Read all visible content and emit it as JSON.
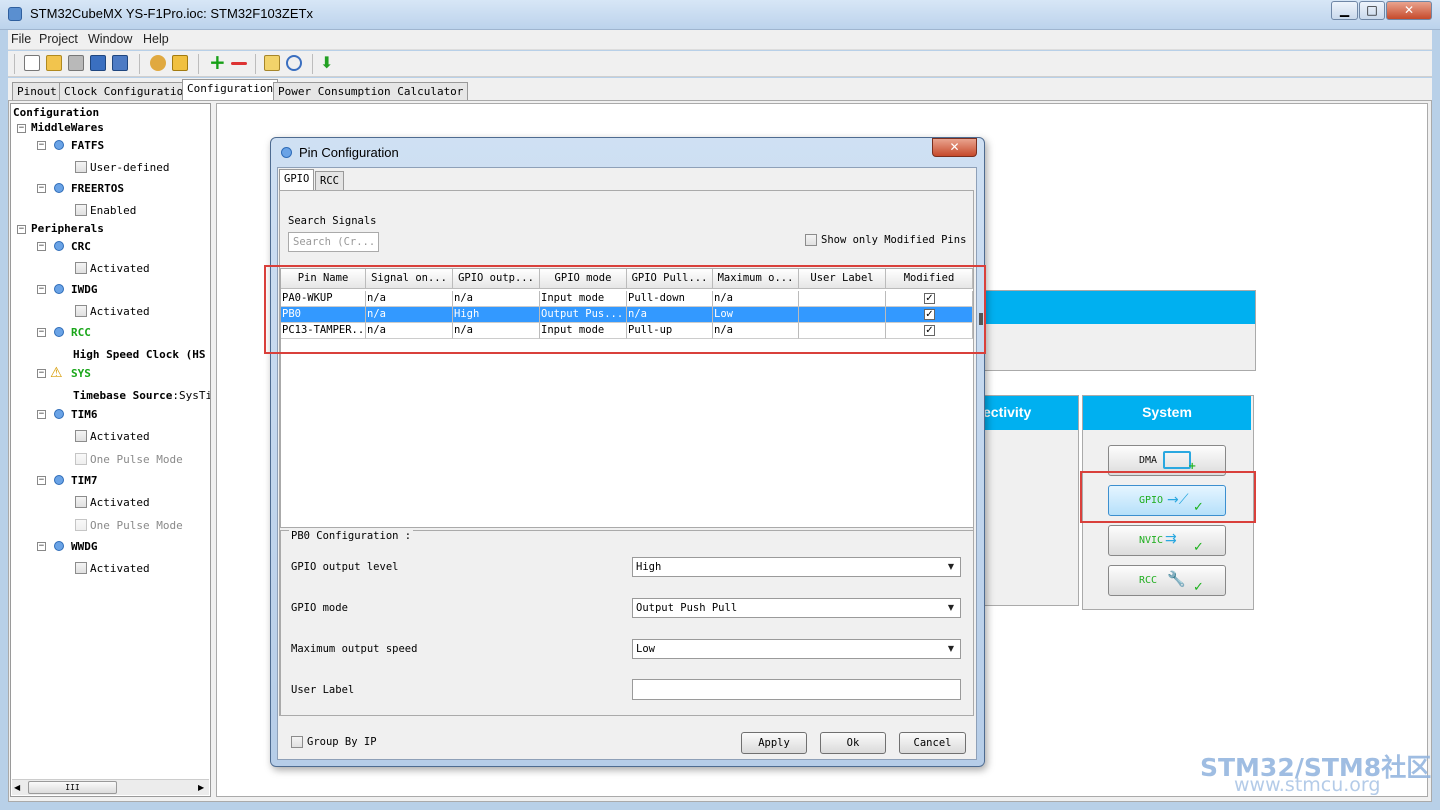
{
  "window": {
    "title": "STM32CubeMX YS-F1Pro.ioc: STM32F103ZETx",
    "min": "▁",
    "max": "□",
    "close": "✕"
  },
  "menu": [
    "File",
    "Project",
    "Window",
    "Help"
  ],
  "tabs": [
    "Pinout",
    "Clock Configuration",
    "Configuration",
    "Power Consumption Calculator"
  ],
  "tree": {
    "root": "Configuration",
    "middlewares": "MiddleWares",
    "fatfs": "FATFS",
    "fatfs_opt": "User-defined",
    "freertos": "FREERTOS",
    "freertos_opt": "Enabled",
    "peripherals": "Peripherals",
    "crc": "CRC",
    "crc_opt": "Activated",
    "iwdg": "IWDG",
    "iwdg_opt": "Activated",
    "rcc": "RCC",
    "rcc_opt_label": "High Speed Clock (HS",
    "sys": "SYS",
    "sys_opt_label": "Timebase Source",
    "sys_opt_value": ":SysTi",
    "tim6": "TIM6",
    "tim6_opt1": "Activated",
    "tim6_opt2": "One Pulse Mode",
    "tim7": "TIM7",
    "tim7_opt1": "Activated",
    "tim7_opt2": "One Pulse Mode",
    "wwdg": "WWDG",
    "wwdg_opt": "Activated",
    "scroll_thumb": "III"
  },
  "canvas": {
    "connectivity_header": "ectivity",
    "system_header": "System",
    "buttons": [
      "DMA",
      "GPIO",
      "NVIC",
      "RCC"
    ]
  },
  "dialog": {
    "title": "Pin Configuration",
    "close": "✕",
    "tabs": [
      "GPIO",
      "RCC"
    ],
    "search_label": "Search Signals",
    "search_placeholder": "Search (Cr...",
    "show_modified": "Show only Modified Pins",
    "columns": [
      "Pin Name",
      "Signal on...",
      "GPIO outp...",
      "GPIO mode",
      "GPIO Pull...",
      "Maximum o...",
      "User Label",
      "Modified"
    ],
    "rows": [
      [
        "PA0-WKUP",
        "n/a",
        "n/a",
        "Input mode",
        "Pull-down",
        "n/a",
        "",
        "✓"
      ],
      [
        "PB0",
        "n/a",
        "High",
        "Output Pus...",
        "n/a",
        "Low",
        "",
        "✓"
      ],
      [
        "PC13-TAMPER...",
        "n/a",
        "n/a",
        "Input mode",
        "Pull-up",
        "n/a",
        "",
        "✓"
      ]
    ],
    "config_title": "PB0 Configuration :",
    "fields": [
      {
        "label": "GPIO output level",
        "value": "High"
      },
      {
        "label": "GPIO mode",
        "value": "Output Push Pull"
      },
      {
        "label": "Maximum output speed",
        "value": "Low"
      },
      {
        "label": "User Label",
        "value": ""
      }
    ],
    "group_by_ip": "Group By IP",
    "apply": "Apply",
    "ok": "Ok",
    "cancel": "Cancel"
  },
  "watermark": {
    "brand": "STM32/STM8社区",
    "url": "www.stmcu.org"
  }
}
